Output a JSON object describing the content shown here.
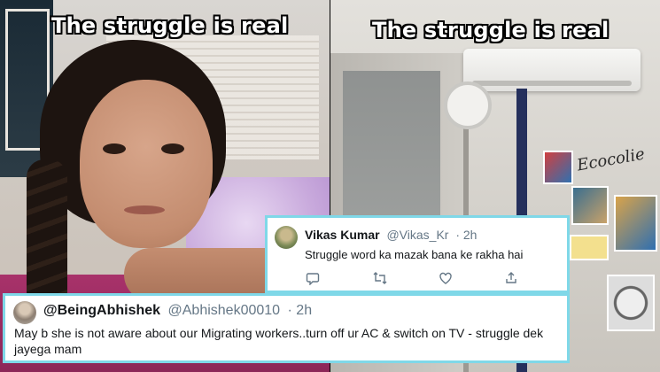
{
  "captions": {
    "left": "The struggle is real",
    "right": "The struggle is real"
  },
  "wall_sign": "Ecocolie",
  "tweets": [
    {
      "name": "Vikas Kumar",
      "handle": "@Vikas_Kr",
      "time": "· 2h",
      "text": "Struggle word ka mazak bana ke rakha hai",
      "actions": [
        "reply-icon",
        "retweet-icon",
        "like-icon",
        "share-icon"
      ]
    },
    {
      "name": "@BeingAbhishek",
      "handle": "@Abhishek00010",
      "time": "· 2h",
      "text": "May b she is not aware about our Migrating workers..turn off ur AC & switch on TV - struggle dek jayega mam"
    }
  ],
  "colors": {
    "card_border": "#7fd8e8",
    "name": "#14171a",
    "meta": "#657786",
    "bed": "#a8326a"
  }
}
